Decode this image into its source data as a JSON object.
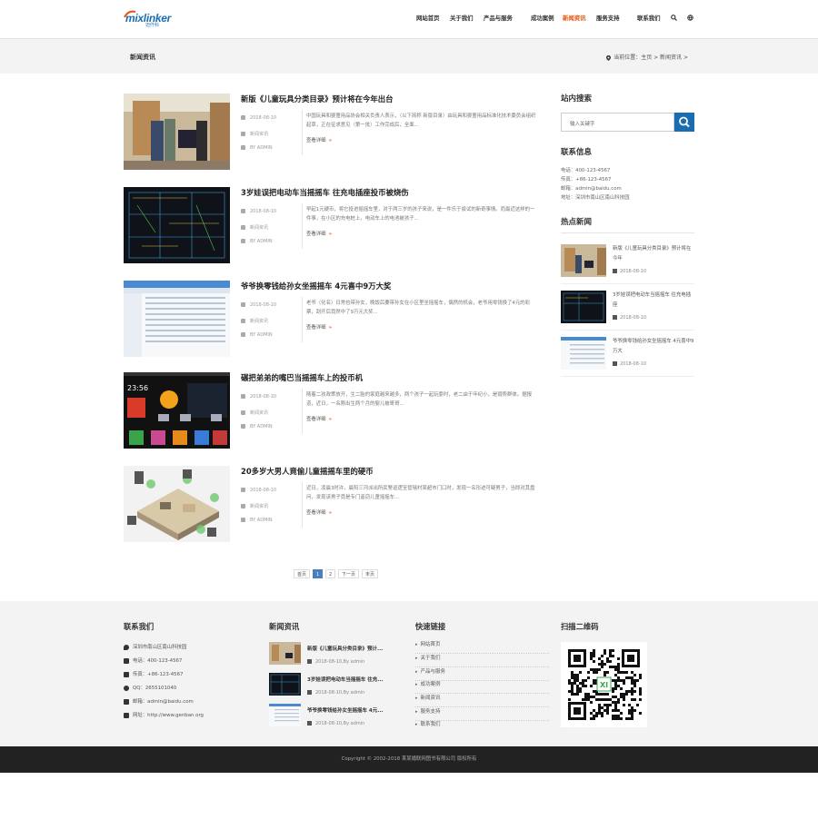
{
  "header": {
    "logo_text_mix": "mix",
    "logo_text_linker": "linker",
    "logo_sub": "迈仟科",
    "nav": [
      {
        "label": "网站首页",
        "active": false,
        "dropdown": false
      },
      {
        "label": "关于我们",
        "active": false,
        "dropdown": false
      },
      {
        "label": "产品与服务",
        "active": false,
        "dropdown": true
      },
      {
        "label": "成功案例",
        "active": false,
        "dropdown": false
      },
      {
        "label": "新闻资讯",
        "active": true,
        "dropdown": false
      },
      {
        "label": "服务支持",
        "active": false,
        "dropdown": true
      },
      {
        "label": "联系我们",
        "active": false,
        "dropdown": false
      }
    ],
    "accent_color": "#e8540f",
    "brand_color": "#1a6db0"
  },
  "banner": {
    "page_title": "新闻资讯",
    "breadcrumb": "当前位置：主页 > 新闻资讯 >"
  },
  "articles": [
    {
      "title": "新版《儿童玩具分类目录》预计将在今年出台",
      "date": "2018-08-10",
      "category": "新闻资讯",
      "author": "BY ADMIN",
      "desc": "中国玩具和婴童用品协会相关负责人表示，（以下简称 新版目录）由玩具和婴童用品标准化技术委员会组织起草，正在征求意见（第一批）工作完成后，全面... ",
      "more": "查看详细"
    },
    {
      "title": "3岁娃误把电动车当摇摇车 往充电插座投币被烧伤",
      "date": "2018-08-10",
      "category": "新闻资讯",
      "author": "BY ADMIN",
      "desc": "早起1元硬币，将它投进摇摇车里，对于两三岁的孩子来说，是一件乐于尝试的新奇事情。而最近这样的一件事，在小区的充电桩上，电动车上的电池被孩子... ",
      "more": "查看详细"
    },
    {
      "title": "爷爷换零钱给孙女坐摇摇车 4元喜中9万大奖",
      "date": "2018-08-10",
      "category": "新闻资讯",
      "author": "BY ADMIN",
      "desc": "老爷（化名）日常也带孙女，晚饭后要带孙女在小区里坐摇摇车，偶然的机会，老爷用零钱换了4元的彩票，刮开后竟然中了9万元大奖... ",
      "more": "查看详细"
    },
    {
      "title": "碾把弟弟的嘴巴当摇摇车上的投币机",
      "date": "2018-08-10",
      "category": "新闻资讯",
      "author": "BY ADMIN",
      "desc": "随着二孩政策放开，生二胎的家庭越来越多，两个孩子一起玩耍时，老二由于年纪小，是弱势群体。据报道，近日，一名刚出生两个月的婴儿被哥哥... ",
      "more": "查看详细"
    },
    {
      "title": "20多岁大男人竟偷儿童摇摇车里的硬币",
      "date": "2018-08-10",
      "category": "新闻资讯",
      "author": "BY ADMIN",
      "desc": "近日，凌晨3时许，晨阳三河派出所民警巡逻至管辖村某超市门口时，发现一名形迹可疑男子，当即对其盘问，发现该男子竟是专门盗窃儿童摇摇车... ",
      "more": "查看详细"
    }
  ],
  "pagination": [
    "首页",
    "1",
    "2",
    "下一页",
    "末页"
  ],
  "sidebar": {
    "search_title": "站内搜索",
    "search_placeholder": "输入关键字",
    "contact_title": "联系信息",
    "contact_lines": [
      "电话：400-123-4567",
      "传真：+86-123-4567",
      "邮箱：admin@baidu.com",
      "地址：深圳市南山区南山科技园"
    ],
    "hot_title": "热点新闻",
    "hot": [
      {
        "title": "新版《儿童玩具分类目录》预计将在今年",
        "date": "2018-08-10"
      },
      {
        "title": "3岁娃误把电动车当摇摇车 往充电插座",
        "date": "2018-08-10"
      },
      {
        "title": "爷爷换零钱给孙女坐摇摇车 4元喜中9万大",
        "date": "2018-08-10"
      }
    ]
  },
  "footer": {
    "contact_title": "联系我们",
    "contact": [
      {
        "icon": "location-icon",
        "text": "深圳市南山区南山科技园"
      },
      {
        "icon": "phone-icon",
        "text": "电话：400-123-4567"
      },
      {
        "icon": "fax-icon",
        "text": "传真：+86-123-4567"
      },
      {
        "icon": "qq-icon",
        "text": "QQ：2655101040"
      },
      {
        "icon": "mail-icon",
        "text": "邮箱：admin@baidu.com"
      },
      {
        "icon": "home-icon",
        "text": "网址：http://www.genban.org"
      }
    ],
    "news_title": "新闻资讯",
    "news": [
      {
        "title": "新版《儿童玩具分类目录》预计...",
        "date": "2018-08-10,By admin"
      },
      {
        "title": "3岁娃误把电动车当摇摇车 往充...",
        "date": "2018-08-10,By admin"
      },
      {
        "title": "爷爷换零钱给孙女坐摇摇车 4元...",
        "date": "2018-08-10,By admin"
      }
    ],
    "links_title": "快速链接",
    "links": [
      "网站首页",
      "关于我们",
      "产品与服务",
      "成功案例",
      "新闻资讯",
      "服务支持",
      "联系我们"
    ],
    "qr_title": "扫描二维码",
    "copyright": "Copyright © 2002-2018 某某婚联网图书有限公司 版权所有"
  }
}
